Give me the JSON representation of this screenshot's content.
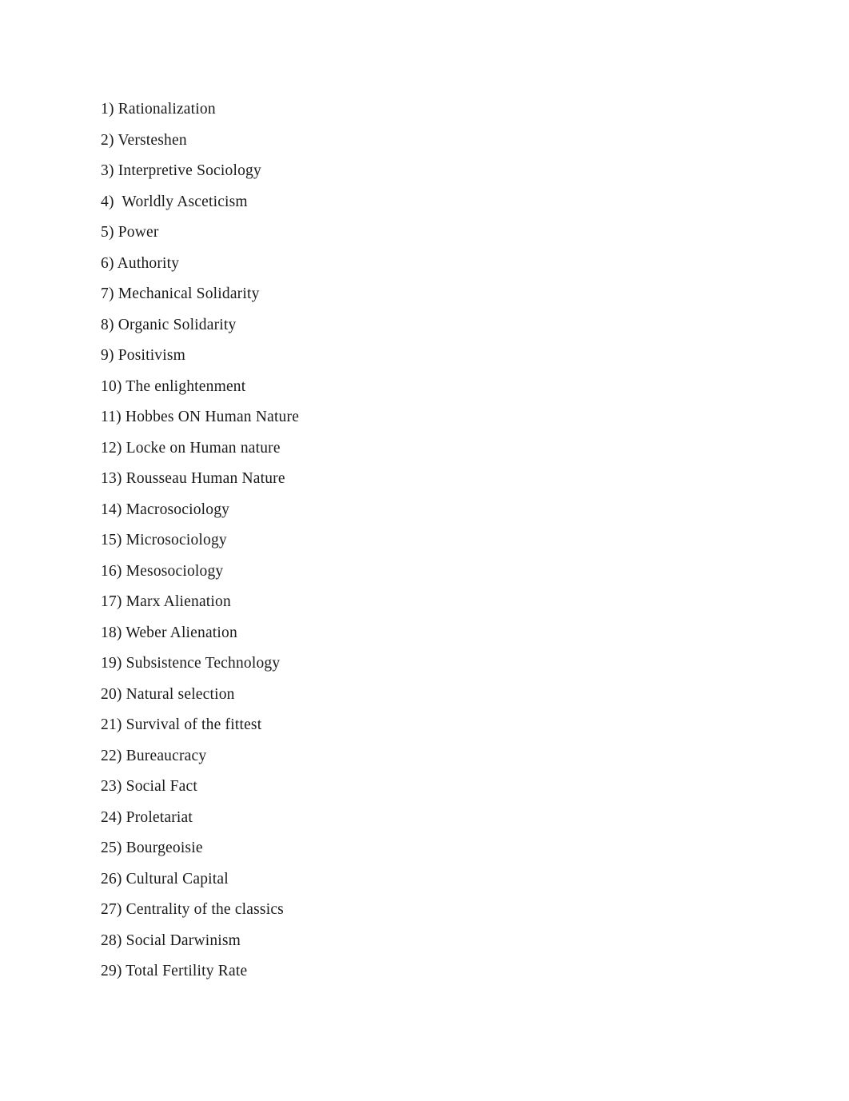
{
  "document": {
    "background_color": "#ffffff",
    "text_color": "#1a1a1a",
    "terms": [
      {
        "label": "1) Rationalization"
      },
      {
        "label": "2) Versteshen"
      },
      {
        "label": "3) Interpretive Sociology"
      },
      {
        "label": "4)  Worldly Asceticism"
      },
      {
        "label": "5) Power"
      },
      {
        "label": "6) Authority"
      },
      {
        "label": "7) Mechanical Solidarity"
      },
      {
        "label": "8) Organic Solidarity"
      },
      {
        "label": "9) Positivism"
      },
      {
        "label": "10) The enlightenment"
      },
      {
        "label": "11) Hobbes ON Human Nature"
      },
      {
        "label": "12) Locke on Human nature"
      },
      {
        "label": "13) Rousseau Human Nature"
      },
      {
        "label": "14) Macrosociology"
      },
      {
        "label": "15) Microsociology"
      },
      {
        "label": "16) Mesosociology"
      },
      {
        "label": "17) Marx Alienation"
      },
      {
        "label": "18) Weber Alienation"
      },
      {
        "label": "19) Subsistence Technology"
      },
      {
        "label": "20) Natural selection"
      },
      {
        "label": "21) Survival of the fittest"
      },
      {
        "label": "22) Bureaucracy"
      },
      {
        "label": "23) Social Fact"
      },
      {
        "label": "24) Proletariat"
      },
      {
        "label": "25) Bourgeoisie"
      },
      {
        "label": "26) Cultural Capital"
      },
      {
        "label": "27) Centrality of the classics"
      },
      {
        "label": "28) Social Darwinism"
      },
      {
        "label": "29) Total Fertility Rate"
      }
    ]
  }
}
